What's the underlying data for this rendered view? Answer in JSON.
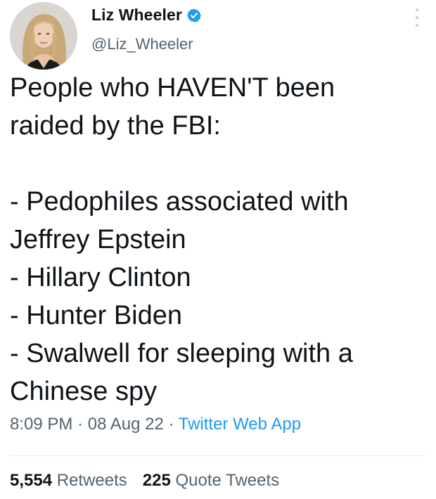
{
  "author": {
    "display_name": "Liz Wheeler",
    "handle": "@Liz_Wheeler",
    "verified_icon": "verified-badge-icon",
    "avatar": "profile-photo"
  },
  "tweet": {
    "text": "People who HAVEN'T been\nraided by the FBI:\n\n- Pedophiles associated with\nJeffrey Epstein\n- Hillary Clinton\n- Hunter Biden\n- Swalwell for sleeping with a\nChinese spy",
    "time": "8:09 PM",
    "date": "08 Aug 22",
    "separator": " · ",
    "source": "Twitter Web App"
  },
  "stats": {
    "retweets_count": "5,554",
    "retweets_label": "Retweets",
    "quotes_count": "225",
    "quotes_label": "Quote Tweets"
  },
  "colors": {
    "accent": "#1d9bf0",
    "secondary_text": "#536471",
    "primary_text": "#0f1419"
  }
}
